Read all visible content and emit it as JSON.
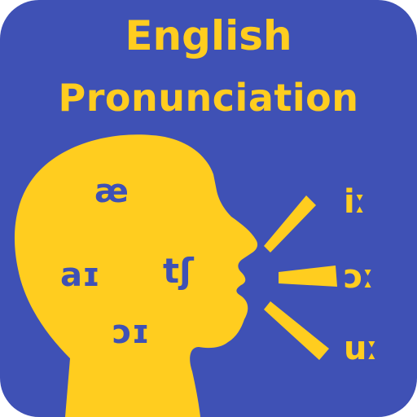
{
  "colors": {
    "background": "#3F51B5",
    "accent": "#FFCD1F",
    "phoneme_text": "#3F51B5"
  },
  "title": {
    "line1": "English",
    "line2": "Pronunciation"
  },
  "head_symbols": [
    "æ",
    "aɪ",
    "tʃ",
    "ɔɪ"
  ],
  "voice_symbols": [
    "iː",
    "ɔː",
    "uː"
  ],
  "icons": [
    "speaking-head-silhouette",
    "sound-wave-rays"
  ]
}
